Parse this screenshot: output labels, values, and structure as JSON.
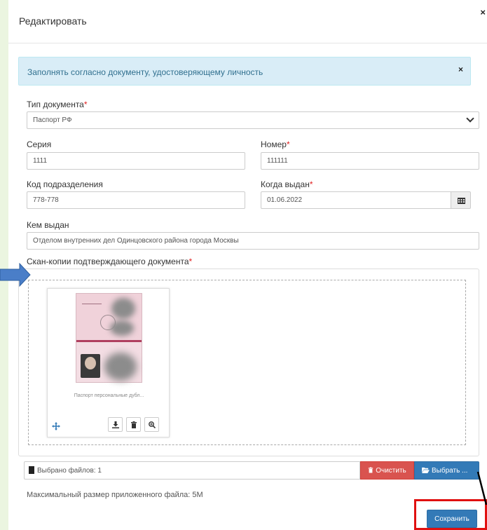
{
  "modal": {
    "title": "Редактировать",
    "close_symbol": "×"
  },
  "alert": {
    "text": "Заполнять согласно документу, удостоверяющему личность",
    "close_symbol": "×"
  },
  "form": {
    "doc_type": {
      "label": "Тип документа",
      "required_mark": "*",
      "value": "Паспорт РФ"
    },
    "series": {
      "label": "Серия",
      "value": "1111"
    },
    "number": {
      "label": "Номер",
      "required_mark": "*",
      "value": "111111"
    },
    "division_code": {
      "label": "Код подразделения",
      "value": "778-778"
    },
    "issue_date": {
      "label": "Когда выдан",
      "required_mark": "*",
      "value": "01.06.2022",
      "icon": "calendar-icon"
    },
    "issued_by": {
      "label": "Кем выдан",
      "value": "Отделом внутренних дел Одинцовского района города Москвы"
    },
    "scans": {
      "label": "Скан-копии подтверждающего документа",
      "required_mark": "*"
    }
  },
  "upload": {
    "thumbnail_caption": "Паспорт персональные дубл...",
    "thumbnail_icons": [
      "download-icon",
      "trash-icon",
      "zoom-in-icon"
    ],
    "move_icon": "move-icon",
    "selected_text": "Выбрано файлов: 1",
    "clear_label": "Очистить",
    "choose_label": "Выбрать ...",
    "max_size_text": "Максимальный размер приложенного файла: 5M"
  },
  "footer": {
    "save_label": "Сохранить"
  },
  "colors": {
    "primary": "#337ab7",
    "danger": "#d9534f",
    "alert_bg": "#d9edf7",
    "alert_text": "#31708f",
    "required": "#e02020",
    "page_bg": "#ebf5e0",
    "highlight_box": "#e01010",
    "annotation_arrow": "#4a7ec8"
  }
}
